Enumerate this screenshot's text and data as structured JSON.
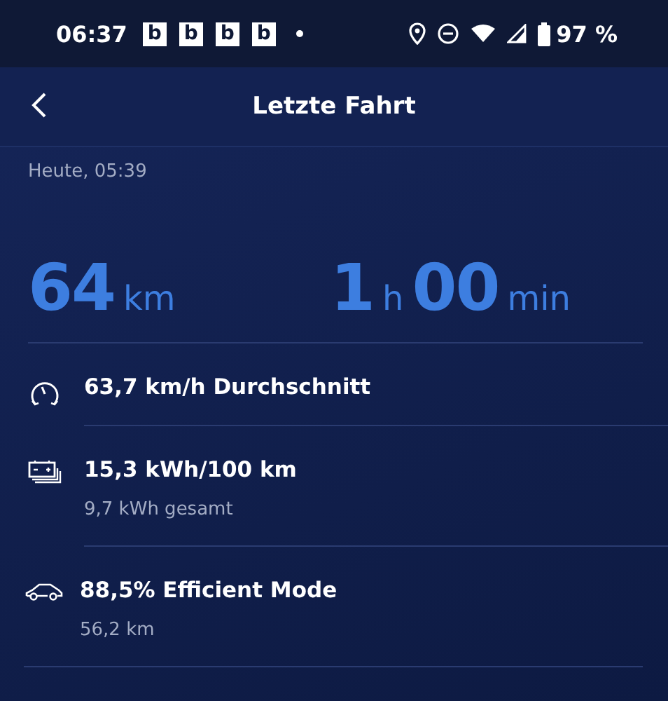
{
  "status_bar": {
    "time": "06:37",
    "notifications": [
      "b",
      "b",
      "b",
      "b"
    ],
    "battery": "97 %"
  },
  "header": {
    "title": "Letzte Fahrt"
  },
  "date": "Heute, 05:39",
  "stats": [
    {
      "parts": [
        {
          "value": "64",
          "unit": "km"
        }
      ]
    },
    {
      "parts": [
        {
          "value": "1",
          "unit": "h"
        },
        {
          "value": "00",
          "unit": "min"
        }
      ]
    }
  ],
  "rows": [
    {
      "kind": "speed",
      "title": "63,7 km/h Durchschnitt"
    },
    {
      "kind": "battery",
      "title": "15,3 kWh/100 km",
      "subtitle": "9,7 kWh gesamt"
    },
    {
      "kind": "car",
      "title": "88,5% Efficient Mode",
      "subtitle": "56,2 km"
    }
  ]
}
